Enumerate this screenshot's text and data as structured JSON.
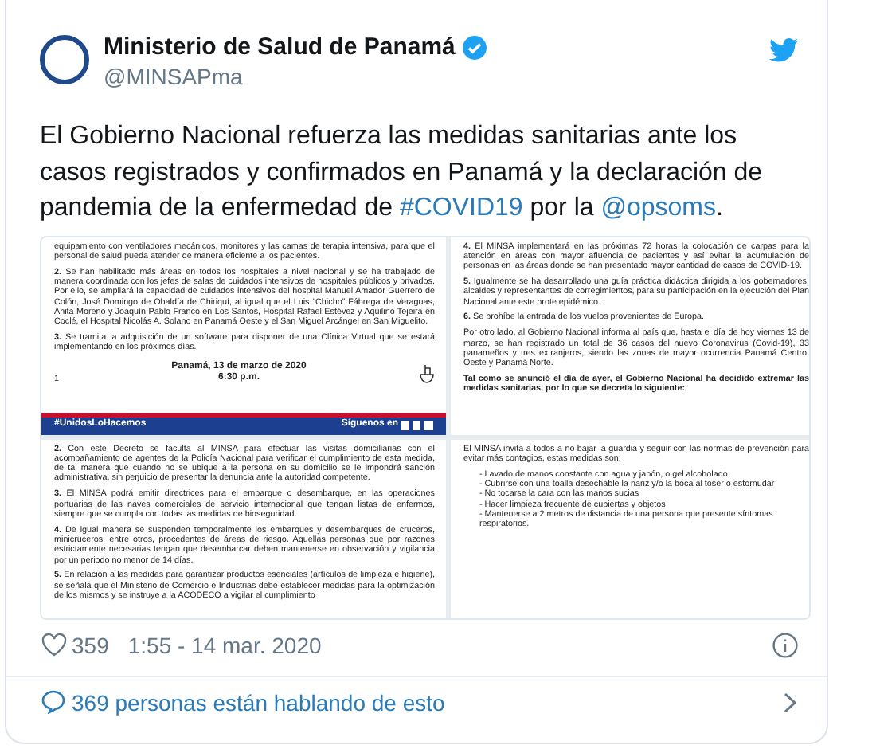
{
  "account": {
    "name": "Ministerio de Salud de Panamá",
    "handle": "@MINSAPma",
    "verified": true
  },
  "tweet_text": [
    {
      "kind": "text",
      "text": "El Gobierno Nacional refuerza las medidas sanitarias ante los casos registrados y confirmados en Panamá y la declaración de pandemia de la enfermedad de "
    },
    {
      "kind": "hashtag",
      "text": "#COVID19"
    },
    {
      "kind": "text",
      "text": " por la "
    },
    {
      "kind": "mention",
      "text": "@opsoms"
    },
    {
      "kind": "text",
      "text": "."
    }
  ],
  "images": [
    {
      "blocks": [
        {
          "kind": "para",
          "text": "equipamiento con ventiladores mecánicos, monitores y las camas de terapia intensiva, para que el personal de salud pueda atender de manera eficiente a los pacientes."
        },
        {
          "kind": "para",
          "text": "**2.** Se han habilitado más áreas en todos los hospitales a nivel nacional y se ha trabajado de manera coordinada con los jefes de salas de cuidados intensivos de hospitales públicos y privados. Por ello, se ampliará la capacidad de cuidados intensivos del hospital Manuel Amador Guerrero de Colón, José Domingo de Obaldía de Chiriquí, al igual que el Luis “Chicho” Fábrega de Veraguas, Anita Moreno y Joaquín Pablo Franco en Los Santos, Hospital Rafael Estévez y Aquilino Tejeira en Coclé, el Hospital Nicolás A. Solano en Panamá Oeste y el San Miguel Arcángel en San Miguelito."
        },
        {
          "kind": "para",
          "text": "**3.** Se tramita la adquisición de un software para disponer de una Clínica Virtual que se estará implementando en los próximos días."
        },
        {
          "kind": "signature",
          "page": "1",
          "lines": [
            "Panamá, 13 de marzo de 2020",
            "6:30 p.m."
          ]
        },
        {
          "kind": "band",
          "hashtag": "#UnidosLoHacemos",
          "follow": "Síguenos en"
        }
      ]
    },
    {
      "blocks": [
        {
          "kind": "para",
          "text": "**4.** El MINSA implementará en las próximas 72 horas la colocación de carpas para la atención en áreas con mayor afluencia de pacientes y así evitar la acumulación de personas en las áreas donde se han presentado mayor cantidad de casos de COVID-19."
        },
        {
          "kind": "para",
          "text": "**5.** Igualmente se ha desarrollado una guía práctica didáctica dirigida a los gobernadores, alcaldes y representantes de corregimientos, para su participación en la ejecución del Plan Nacional ante este brote epidémico."
        },
        {
          "kind": "para",
          "text": "**6.** Se prohíbe la entrada de los vuelos provenientes de Europa."
        },
        {
          "kind": "para",
          "text": "Por otro lado, al Gobierno Nacional informa al país que, hasta el día de hoy viernes 13 de marzo, se han registrado un total de 36 casos del nuevo Coronavirus (Covid-19), 33 panameños y tres extranjeros, siendo las zonas de mayor ocurrencia Panamá Centro, Oeste y Panamá Norte."
        },
        {
          "kind": "bold",
          "text": "Tal como se anunció el día de ayer, el Gobierno Nacional ha decidido extremar las medidas sanitarias, por lo que se decreta lo siguiente:"
        }
      ]
    },
    {
      "blocks": [
        {
          "kind": "para",
          "text": "**2.** Con este Decreto se faculta al MINSA para efectuar las visitas domiciliarias con el acompañamiento de agentes de la Policía Nacional para verificar el cumplimiento de esta medida, de tal manera que cuando no se ubique a la persona en su domicilio se le impondrá sanción administrativa, sin perjuicio de presentar la denuncia ante la autoridad competente."
        },
        {
          "kind": "para",
          "text": "**3.** El MINSA podrá emitir directrices para el embarque o desembarque, en las operaciones portuarias de las naves comerciales de servicio internacional que tengan listas de enfermos, siempre que se cumpla con todas las medidas de bioseguridad."
        },
        {
          "kind": "para",
          "text": "**4.** De igual manera se suspenden temporalmente los embarques y desembarques de cruceros, minicruceros, entre otros, procedentes de áreas de riesgo. Aquellas personas que por razones estrictamente necesarias tengan que desembarcar deben mantenerse en observación y vigilancia por un periodo no menor de 14 días."
        },
        {
          "kind": "para",
          "text": "**5.** En relación a las medidas para garantizar productos esenciales (artículos de limpieza e higiene), se señala que el Ministerio de Comercio e Industrias debe establecer medidas para la optimización de los mismos y se instruye a la ACODECO a vigilar el cumplimiento"
        }
      ]
    },
    {
      "blocks": [
        {
          "kind": "para",
          "text": "El MINSA invita a todos a no bajar la guardia y seguir con las normas de prevención para evitar más contagios, estas medidas son:"
        },
        {
          "kind": "bullet",
          "text": "- Lavado de manos constante con agua y jabón, o gel alcoholado"
        },
        {
          "kind": "bullet",
          "text": "- Cubrirse con una toalla desechable la nariz y/o la boca al toser o estornudar"
        },
        {
          "kind": "bullet",
          "text": "- No tocarse la cara con las manos sucias"
        },
        {
          "kind": "bullet",
          "text": "- Hacer limpieza frecuente de cubiertas y objetos"
        },
        {
          "kind": "bullet",
          "text": "- Mantenerse a 2 metros de distancia de una persona que presente síntomas respiratorios."
        }
      ]
    }
  ],
  "likes": "359",
  "timestamp": "1:55 - 14 mar. 2020",
  "conversation": "369 personas están hablando de esto"
}
